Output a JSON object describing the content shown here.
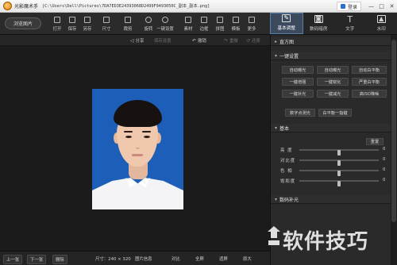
{
  "window": {
    "app_name": "光影魔术手",
    "title_path": "[C:\\Users\\Dell\\Pictures\\7DA7ED3E24393068D2499F9493050C_副本_副本.png]",
    "login_label": "登录",
    "minimize_glyph": "—",
    "maximize_glyph": "□",
    "close_glyph": "✕"
  },
  "toolbar": {
    "browse_label": "浏览图片",
    "tools": [
      {
        "label": "打开",
        "icon": "open-icon"
      },
      {
        "label": "保存",
        "icon": "save-icon"
      },
      {
        "label": "另存",
        "icon": "save-as-icon"
      },
      {
        "label": "尺寸",
        "icon": "resize-icon"
      },
      {
        "label": "裁剪",
        "icon": "crop-icon"
      },
      {
        "label": "旋转",
        "icon": "rotate-icon"
      },
      {
        "label": "一键设置",
        "icon": "one-click-icon"
      },
      {
        "label": "素材",
        "icon": "material-icon"
      },
      {
        "label": "边框",
        "icon": "border-icon"
      },
      {
        "label": "拼图",
        "icon": "collage-icon"
      },
      {
        "label": "模板",
        "icon": "template-icon"
      },
      {
        "label": "更多",
        "icon": "more-icon"
      }
    ]
  },
  "mode_tabs": [
    {
      "label": "基本调整",
      "icon": "adjust-icon",
      "glyph": "✎",
      "active": true
    },
    {
      "label": "数码暗房",
      "icon": "darkroom-icon",
      "glyph": "◙",
      "active": false
    },
    {
      "label": "文字",
      "icon": "text-icon",
      "glyph": "T",
      "active": false
    },
    {
      "label": "水印",
      "icon": "watermark-icon",
      "glyph": "▲",
      "active": false
    }
  ],
  "action_row": {
    "share": "分享",
    "share_icon": "◁",
    "save_settings": "保存设置",
    "undo": "撤销",
    "undo_icon": "↶",
    "redo": "重做",
    "redo_icon": "↷",
    "restore": "还原",
    "restore_icon": "↺"
  },
  "statusbar": {
    "prev": "上一张",
    "next": "下一张",
    "delete": "删除",
    "size_label": "尺寸：240 × 320",
    "image_info": "图片信息",
    "compare": "对比",
    "fullscreen": "全屏",
    "fit": "适屏",
    "actual": "原大"
  },
  "panel": {
    "histogram_title": "直方图",
    "oneclick_title": "一键设置",
    "oneclick_buttons": [
      "自动曝光",
      "自动曝光",
      "自动白平衡",
      "一键增强",
      "一键锐化",
      "严重白平衡",
      "一键补光",
      "一键减光",
      "高ISO降噪"
    ],
    "extra_buttons": [
      "数字点测光",
      "白平衡一指键"
    ],
    "basic_title": "基本",
    "reset_label": "重置",
    "sliders": [
      {
        "label": "亮 度",
        "value": 0,
        "level": 0.5
      },
      {
        "label": "对比度",
        "value": 0,
        "level": 0.5
      },
      {
        "label": "色 相",
        "value": 0,
        "level": 0.5
      },
      {
        "label": "饱和度",
        "value": 0,
        "level": 0.5
      }
    ],
    "fill_title": "数码补光"
  },
  "watermark_text": "软件技巧"
}
